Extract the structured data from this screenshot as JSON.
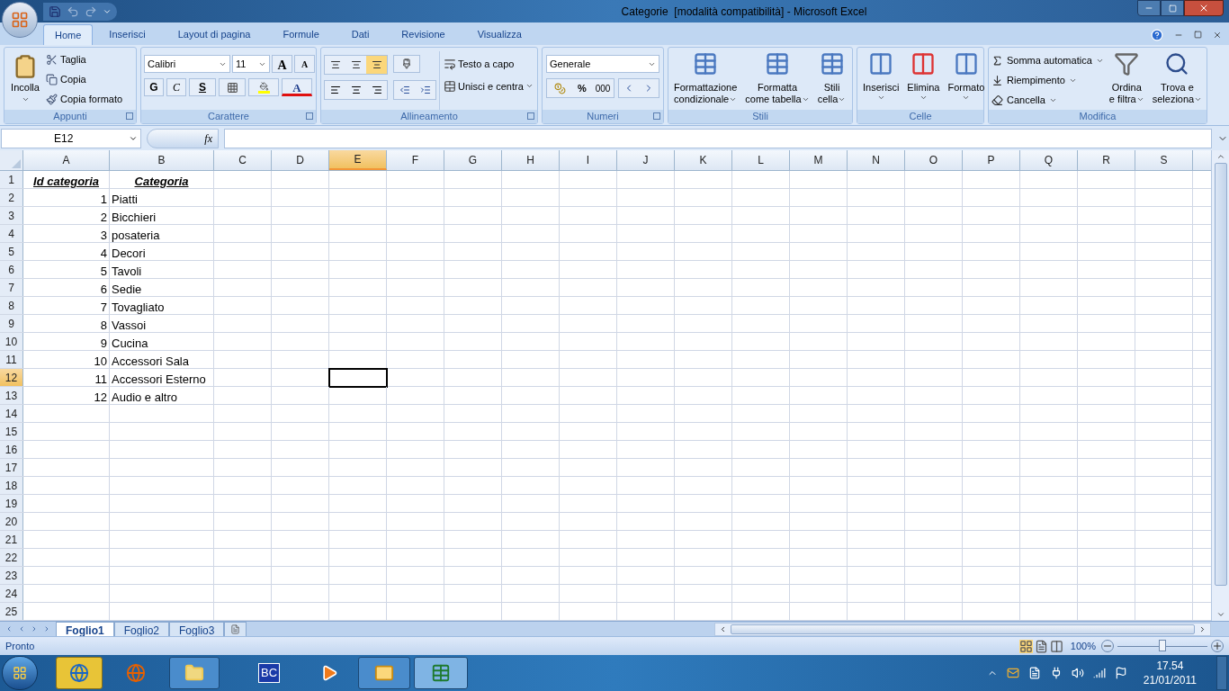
{
  "window": {
    "title": "Categorie  [modalità compatibilità] - Microsoft Excel"
  },
  "tabs": [
    {
      "label": "Home",
      "selected": true
    },
    {
      "label": "Inserisci",
      "selected": false
    },
    {
      "label": "Layout di pagina",
      "selected": false
    },
    {
      "label": "Formule",
      "selected": false
    },
    {
      "label": "Dati",
      "selected": false
    },
    {
      "label": "Revisione",
      "selected": false
    },
    {
      "label": "Visualizza",
      "selected": false
    }
  ],
  "ribbon": {
    "appunti": {
      "label": "Appunti",
      "paste": "Incolla",
      "items": [
        "Taglia",
        "Copia",
        "Copia formato"
      ]
    },
    "carattere": {
      "label": "Carattere",
      "font": "Calibri",
      "size": "11",
      "grow": "A",
      "shrink": "A",
      "bold": "G",
      "italic": "C",
      "underline": "S",
      "font_color": "A"
    },
    "allineamento": {
      "label": "Allineamento",
      "vertical": [
        {
          "selected": false
        },
        {
          "selected": false
        },
        {
          "selected": true
        }
      ],
      "wrap": "Testo a capo",
      "merge": "Unisci e centra"
    },
    "numeri": {
      "label": "Numeri",
      "format": "Generale",
      "percent": "%",
      "thousands": "000"
    },
    "stili": {
      "label": "Stili",
      "buttons": [
        [
          "Formattazione",
          "condizionale"
        ],
        [
          "Formatta",
          "come tabella"
        ],
        [
          "Stili",
          "cella"
        ]
      ]
    },
    "celle": {
      "label": "Celle",
      "buttons": [
        "Inserisci",
        "Elimina",
        "Formato"
      ]
    },
    "modifica": {
      "label": "Modifica",
      "items": [
        "Somma automatica",
        "Riempimento",
        "Cancella"
      ],
      "buttons": [
        [
          "Ordina",
          "e filtra"
        ],
        [
          "Trova e",
          "seleziona"
        ]
      ]
    }
  },
  "formula_bar": {
    "name_box": "E12",
    "fx": "fx"
  },
  "columns": [
    {
      "label": "A",
      "selected": false
    },
    {
      "label": "B",
      "selected": false
    },
    {
      "label": "C",
      "selected": false
    },
    {
      "label": "D",
      "selected": false
    },
    {
      "label": "E",
      "selected": true
    },
    {
      "label": "F",
      "selected": false
    },
    {
      "label": "G",
      "selected": false
    },
    {
      "label": "H",
      "selected": false
    },
    {
      "label": "I",
      "selected": false
    },
    {
      "label": "J",
      "selected": false
    },
    {
      "label": "K",
      "selected": false
    },
    {
      "label": "L",
      "selected": false
    },
    {
      "label": "M",
      "selected": false
    },
    {
      "label": "N",
      "selected": false
    },
    {
      "label": "O",
      "selected": false
    },
    {
      "label": "P",
      "selected": false
    },
    {
      "label": "Q",
      "selected": false
    },
    {
      "label": "R",
      "selected": false
    },
    {
      "label": "S",
      "selected": false
    }
  ],
  "rows": [
    {
      "number": "1",
      "selected": false,
      "kind": "header",
      "cells": [
        "Id categoria",
        "Categoria"
      ]
    },
    {
      "number": "2",
      "selected": false,
      "kind": "data",
      "cells": [
        "1",
        "Piatti"
      ]
    },
    {
      "number": "3",
      "selected": false,
      "kind": "data",
      "cells": [
        "2",
        "Bicchieri"
      ]
    },
    {
      "number": "4",
      "selected": false,
      "kind": "data",
      "cells": [
        "3",
        "posateria"
      ]
    },
    {
      "number": "5",
      "selected": false,
      "kind": "data",
      "cells": [
        "4",
        "Decori"
      ]
    },
    {
      "number": "6",
      "selected": false,
      "kind": "data",
      "cells": [
        "5",
        "Tavoli"
      ]
    },
    {
      "number": "7",
      "selected": false,
      "kind": "data",
      "cells": [
        "6",
        "Sedie"
      ]
    },
    {
      "number": "8",
      "selected": false,
      "kind": "data",
      "cells": [
        "7",
        "Tovagliato"
      ]
    },
    {
      "number": "9",
      "selected": false,
      "kind": "data",
      "cells": [
        "8",
        "Vassoi"
      ]
    },
    {
      "number": "10",
      "selected": false,
      "kind": "data",
      "cells": [
        "9",
        "Cucina"
      ]
    },
    {
      "number": "11",
      "selected": false,
      "kind": "data",
      "cells": [
        "10",
        "Accessori Sala"
      ]
    },
    {
      "number": "12",
      "selected": true,
      "kind": "data",
      "cells": [
        "11",
        "Accessori Esterno"
      ]
    },
    {
      "number": "13",
      "selected": false,
      "kind": "data",
      "cells": [
        "12",
        "Audio e altro"
      ]
    },
    {
      "number": "14",
      "selected": false,
      "kind": "data",
      "cells": []
    },
    {
      "number": "15",
      "selected": false,
      "kind": "data",
      "cells": []
    },
    {
      "number": "16",
      "selected": false,
      "kind": "data",
      "cells": []
    },
    {
      "number": "17",
      "selected": false,
      "kind": "data",
      "cells": []
    },
    {
      "number": "18",
      "selected": false,
      "kind": "data",
      "cells": []
    },
    {
      "number": "19",
      "selected": false,
      "kind": "data",
      "cells": []
    },
    {
      "number": "20",
      "selected": false,
      "kind": "data",
      "cells": []
    },
    {
      "number": "21",
      "selected": false,
      "kind": "data",
      "cells": []
    },
    {
      "number": "22",
      "selected": false,
      "kind": "data",
      "cells": []
    },
    {
      "number": "23",
      "selected": false,
      "kind": "data",
      "cells": []
    },
    {
      "number": "24",
      "selected": false,
      "kind": "data",
      "cells": []
    },
    {
      "number": "25",
      "selected": false,
      "kind": "data",
      "cells": []
    }
  ],
  "sheets": [
    {
      "label": "Foglio1",
      "selected": true
    },
    {
      "label": "Foglio2",
      "selected": false
    },
    {
      "label": "Foglio3",
      "selected": false
    }
  ],
  "status_bar": {
    "text": "Pronto",
    "zoom": "100%",
    "zoom_slider": {
      "level": 0.5
    }
  },
  "taskbar": {
    "bc_label": "BC",
    "time": "17.54",
    "date": "21/01/2011"
  }
}
